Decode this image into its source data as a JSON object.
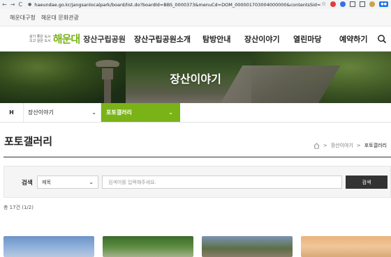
{
  "browser": {
    "url": "haeundae.go.kr/jangsanlocalpark/board/list.do?boardId=BBS_0000373&menuCd=DOM_000001703004000000&contentsSid=2...",
    "back_glyph": "←",
    "forward_glyph": "→",
    "reload_glyph": "C"
  },
  "toplinks": [
    "해운대구청",
    "해운대 문화관광"
  ],
  "logo": {
    "slogan_line1": "살기 좋은 도시",
    "slogan_line2": "오고 싶은 도시",
    "brand": "해운대",
    "park": "장산구립공원"
  },
  "gnb": [
    "장산구립공원소개",
    "탐방안내",
    "장산이야기",
    "열린마당",
    "예약하기"
  ],
  "hero": {
    "title": "장산이야기"
  },
  "subnav": {
    "home": "H",
    "depth1": "장산이야기",
    "depth2": "포토갤러리",
    "chevron": "⌄"
  },
  "page": {
    "title": "포토갤러리",
    "breadcrumb": [
      "장산이야기",
      "포토갤러리"
    ],
    "breadcrumb_sep": ">"
  },
  "search": {
    "label": "검색",
    "select_value": "제목",
    "input_placeholder": "검색어를 입력해주세요.",
    "button": "검색"
  },
  "count": "총 17건 (1/2)",
  "colors": {
    "accent": "#7ab317",
    "dark_button": "#333333"
  }
}
